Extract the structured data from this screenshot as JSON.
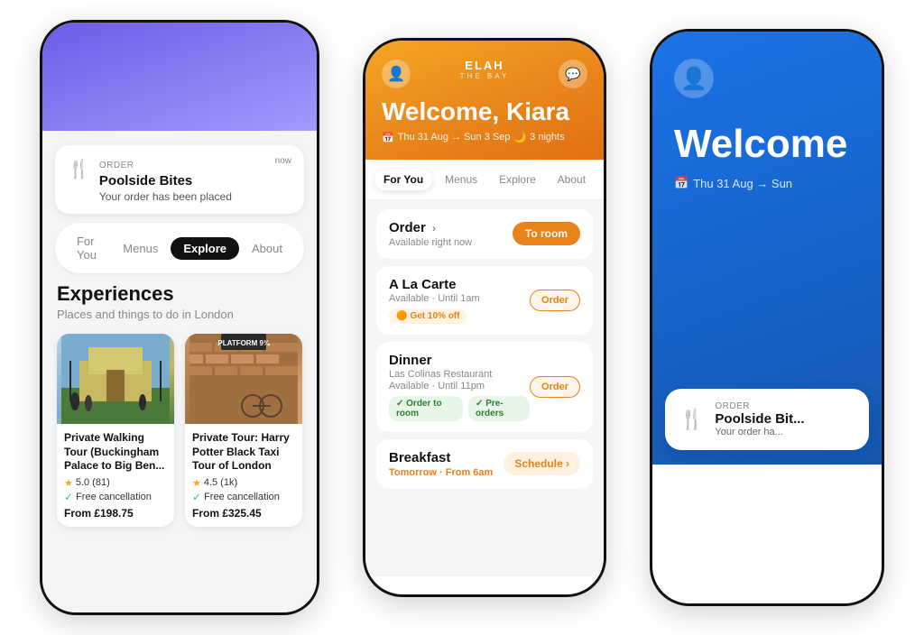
{
  "phone1": {
    "order": {
      "label": "ORDER",
      "timestamp": "now",
      "restaurant": "Poolside Bites",
      "status": "Your order has been placed"
    },
    "tabs": [
      {
        "label": "For You",
        "active": false
      },
      {
        "label": "Menus",
        "active": false
      },
      {
        "label": "Explore",
        "active": true
      },
      {
        "label": "About",
        "active": false
      }
    ],
    "section": {
      "title": "Experiences",
      "subtitle": "Places and things to do in London"
    },
    "experiences": [
      {
        "name": "Private Walking Tour (Buckingham Palace to Big Ben...",
        "rating": "5.0",
        "reviews": "(81)",
        "cancellation": "Free cancellation",
        "price": "From £198.75",
        "image": "palace"
      },
      {
        "name": "Private Tour: Harry Potter Black Taxi Tour of London",
        "rating": "4.5",
        "reviews": "(1k)",
        "cancellation": "Free cancellation",
        "price": "From £325.45",
        "image": "potter",
        "badge": "PLATFORM 9¾"
      }
    ]
  },
  "phone2": {
    "logo": "ELAH",
    "logo_sub": "THE BAY",
    "welcome": "Welcome, Kiara",
    "dates": "Thu 31 Aug → Sun 3 Sep",
    "nights": "3 nights",
    "tabs": [
      {
        "label": "For You",
        "active": true
      },
      {
        "label": "Menus",
        "active": false
      },
      {
        "label": "Explore",
        "active": false
      },
      {
        "label": "About",
        "active": false
      }
    ],
    "menus": [
      {
        "title": "Order",
        "has_arrow": true,
        "subtitle": "Available right now",
        "action": "To room",
        "action_type": "orange"
      },
      {
        "title": "A La Carte",
        "subtitle": "Available · Until 1am",
        "tag": "Get 10% off",
        "action": "Order",
        "action_type": "outline"
      },
      {
        "title": "Dinner",
        "subtitle2": "Las Colinas Restaurant",
        "subtitle": "Available · Until 11pm",
        "tags": [
          "Order to room",
          "Pre-orders"
        ],
        "action": "Order",
        "action_type": "outline"
      },
      {
        "title": "Breakfast",
        "subtitle": "Tomorrow · From 6am",
        "action": "Schedule",
        "action_type": "schedule"
      }
    ]
  },
  "phone3": {
    "welcome_text": "Welcome",
    "dates": "Thu 31 Aug → Sun",
    "order": {
      "label": "ORDER",
      "restaurant": "Poolside Bit...",
      "status": "Your order ha..."
    }
  },
  "icons": {
    "fork_knife": "🍴",
    "avatar": "👤",
    "chat": "💬",
    "calendar": "📅",
    "moon": "🌙",
    "star": "★",
    "check": "✓",
    "arrow_right": "›"
  }
}
